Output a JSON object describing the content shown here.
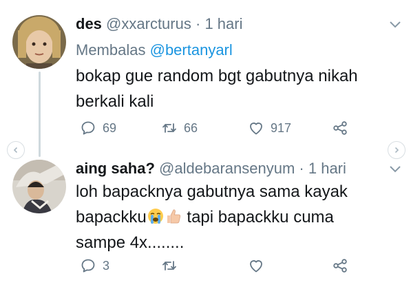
{
  "tweets": [
    {
      "name": "des",
      "handle": "@xxarcturus",
      "separator": "·",
      "time": "1 hari",
      "reply_prefix": "Membalas",
      "reply_to": "@bertanyarl",
      "text_line1": "bokap gue random bgt gabutnya nikah",
      "text_line2": "berkali kali",
      "replies": "69",
      "retweets": "66",
      "likes": "917"
    },
    {
      "name": "aing saha?",
      "handle": "@aldebaransenyum",
      "separator": "·",
      "time": "1 hari",
      "text_line1": "loh bapacknya gabutnya sama kayak",
      "text_line2a": "bapackku",
      "text_line2b": " tapi bapackku cuma",
      "text_line3": "sampe 4x........",
      "replies": "3",
      "retweets": "",
      "likes": ""
    }
  ],
  "icons": {
    "reply": "reply-icon",
    "retweet": "retweet-icon",
    "like": "heart-icon",
    "share": "share-icon",
    "more": "chevron-down-icon",
    "emojis": [
      "loudly-crying-face-icon",
      "thumbs-up-icon"
    ]
  },
  "colors": {
    "text": "#14171a",
    "muted": "#657786",
    "mention": "#1b95e0",
    "thread": "#cfd9de"
  }
}
